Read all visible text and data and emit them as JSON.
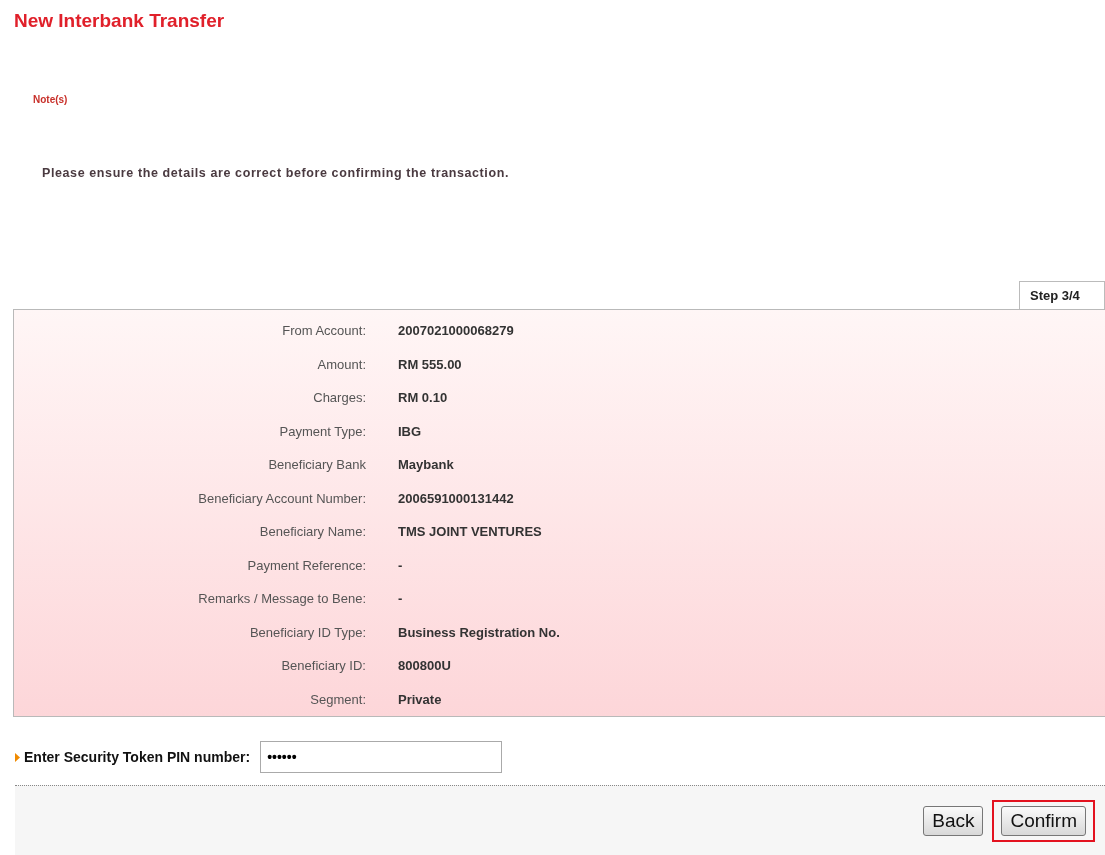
{
  "title": "New Interbank Transfer",
  "notes_label": "Note(s)",
  "note": "Please ensure the details are correct before confirming the transaction.",
  "step": "Step 3/4",
  "details": [
    {
      "label": "From Account:",
      "value": "2007021000068279"
    },
    {
      "label": "Amount:",
      "value": "RM 555.00"
    },
    {
      "label": "Charges:",
      "value": "RM 0.10"
    },
    {
      "label": "Payment Type:",
      "value": "IBG"
    },
    {
      "label": "Beneficiary Bank",
      "value": "Maybank"
    },
    {
      "label": "Beneficiary Account Number:",
      "value": "2006591000131442"
    },
    {
      "label": "Beneficiary Name:",
      "value": "TMS JOINT VENTURES"
    },
    {
      "label": "Payment Reference:",
      "value": "-"
    },
    {
      "label": "Remarks / Message to Bene:",
      "value": "-"
    },
    {
      "label": "Beneficiary ID Type:",
      "value": "Business Registration No."
    },
    {
      "label": "Beneficiary ID:",
      "value": "800800U"
    },
    {
      "label": "Segment:",
      "value": "Private"
    }
  ],
  "pin": {
    "label": "Enter Security Token PIN number:",
    "value": "••••••"
  },
  "buttons": [
    {
      "label": "Back",
      "highlighted": false
    },
    {
      "label": "Confirm",
      "highlighted": true
    }
  ]
}
